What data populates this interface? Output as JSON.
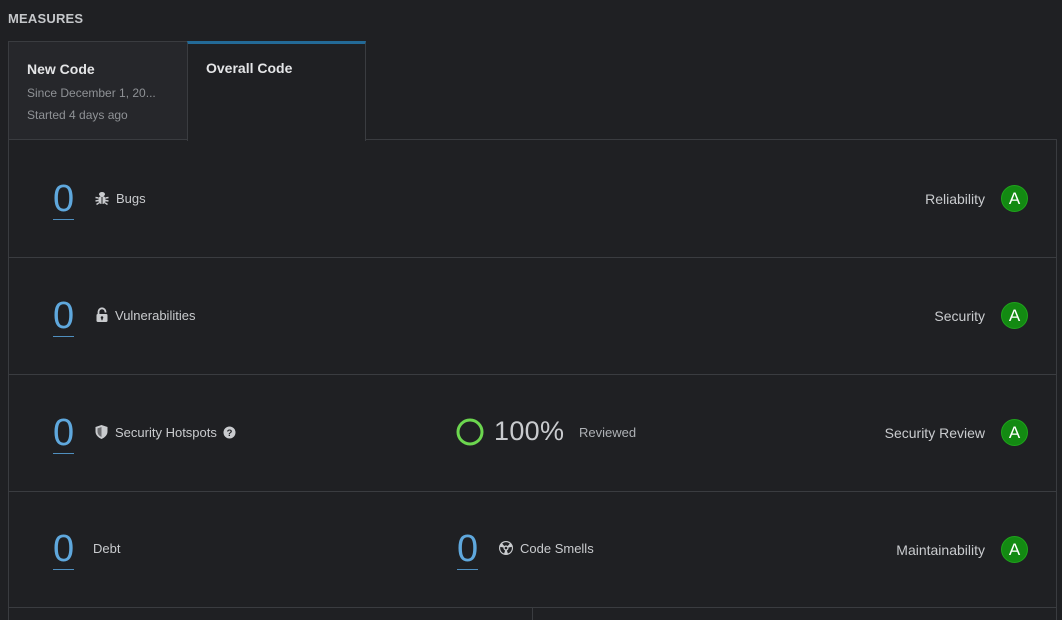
{
  "section_title": "MEASURES",
  "tabs": [
    {
      "title": "New Code",
      "line1": "Since December 1, 20...",
      "line2": "Started 4 days ago"
    },
    {
      "title": "Overall Code"
    }
  ],
  "rows": {
    "bugs": {
      "value": "0",
      "label": "Bugs",
      "rating_label": "Reliability",
      "rating": "A",
      "icon": "bug-icon"
    },
    "vulnerabilities": {
      "value": "0",
      "label": "Vulnerabilities",
      "rating_label": "Security",
      "rating": "A",
      "icon": "lock-icon"
    },
    "hotspots": {
      "value": "0",
      "label": "Security Hotspots",
      "reviewed_pct": "100%",
      "reviewed_label": "Reviewed",
      "rating_label": "Security Review",
      "rating": "A",
      "icon": "shield-icon"
    },
    "maintainability": {
      "debt_value": "0",
      "debt_label": "Debt",
      "smells_value": "0",
      "smells_label": "Code Smells",
      "rating_label": "Maintainability",
      "rating": "A",
      "icon": "code-smell-icon"
    }
  },
  "colors": {
    "background": "#1f2023",
    "value_blue": "#5fa8dd",
    "rating_green": "#138a12",
    "reviewed_ring": "#6cd64f",
    "active_tab_border": "#236a97"
  }
}
